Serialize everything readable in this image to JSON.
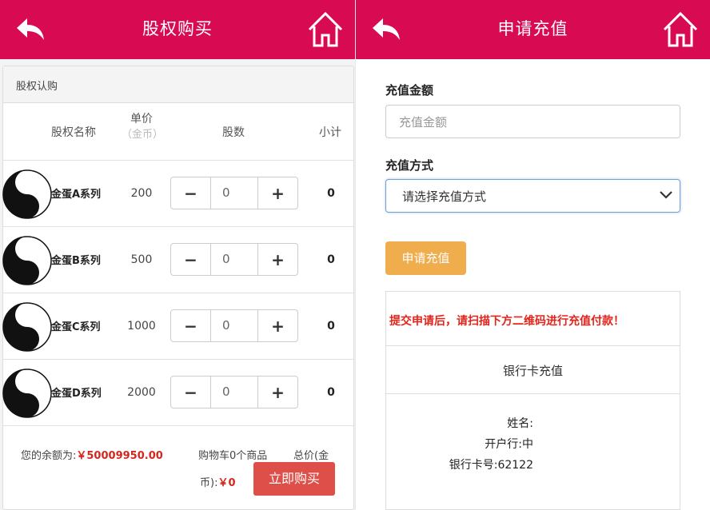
{
  "left": {
    "title": "股权购买",
    "section_title": "股权认购",
    "columns": {
      "name": "股权名称",
      "price": "单价",
      "price_unit": "（金币）",
      "qty": "股数",
      "subtotal": "小计"
    },
    "items": [
      {
        "name": "金蛋A系列",
        "price": "200",
        "qty": "0",
        "subtotal": "0"
      },
      {
        "name": "金蛋B系列",
        "price": "500",
        "qty": "0",
        "subtotal": "0"
      },
      {
        "name": "金蛋C系列",
        "price": "1000",
        "qty": "0",
        "subtotal": "0"
      },
      {
        "name": "金蛋D系列",
        "price": "2000",
        "qty": "0",
        "subtotal": "0"
      }
    ],
    "footer": {
      "balance_label": "您的余额为:",
      "balance_value": "￥50009950.00",
      "cart": "购物车0个商品",
      "total_part1": "总价(金",
      "total_part2": "币):",
      "total_value": "￥0",
      "buy_button": "立即购买"
    }
  },
  "right": {
    "title": "申请充值",
    "amount_label": "充值金额",
    "amount_placeholder": "充值金额",
    "method_label": "充值方式",
    "method_selected": "请选择充值方式",
    "apply_button": "申请充值",
    "notice": "提交申请后，请扫描下方二维码进行充值付款！",
    "bank_title": "银行卡充值",
    "bank_lines": [
      "姓名:",
      "开户行:中",
      "银行卡号:62122"
    ]
  },
  "colors": {
    "header": "#d80b52",
    "price_red": "#d5261d",
    "buy_button": "#dd4f48",
    "apply_button": "#f0ad4e"
  }
}
